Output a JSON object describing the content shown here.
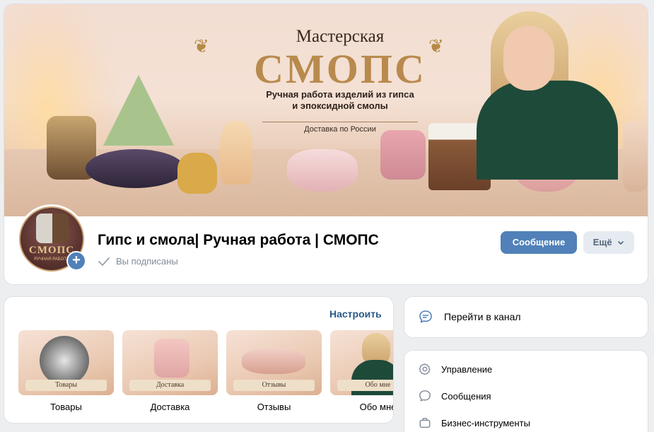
{
  "cover": {
    "title_line1": "Мастерская",
    "title_line2": "СМОПС",
    "subtitle_line1": "Ручная работа изделий из гипса",
    "subtitle_line2": "и эпоксидной смолы",
    "delivery": "Доставка по России"
  },
  "avatar": {
    "text": "СМОПС",
    "small_text": "РУЧНАЯ РАБОТА"
  },
  "group": {
    "name": "Гипс и смола| Ручная работа | СМОПС",
    "subscribed": "Вы подписаны"
  },
  "buttons": {
    "message": "Сообщение",
    "more": "Ещё"
  },
  "showcase": {
    "edit_label": "Настроить",
    "items": [
      {
        "badge": "Товары",
        "caption": "Товары"
      },
      {
        "badge": "Доставка",
        "caption": "Доставка"
      },
      {
        "badge": "Отзывы",
        "caption": "Отзывы"
      },
      {
        "badge": "Обо мне",
        "caption": "Обо мне"
      }
    ]
  },
  "sidebar": {
    "channel_label": "Перейти в канал",
    "menu": [
      {
        "label": "Управление",
        "icon": "gear-icon"
      },
      {
        "label": "Сообщения",
        "icon": "message-icon"
      },
      {
        "label": "Бизнес-инструменты",
        "icon": "briefcase-icon"
      }
    ]
  },
  "colors": {
    "accent": "#5181b8",
    "link": "#2a5885",
    "secondary_button": "#e5ebf1",
    "page_background": "#edeef0",
    "muted_text": "#818c99"
  }
}
